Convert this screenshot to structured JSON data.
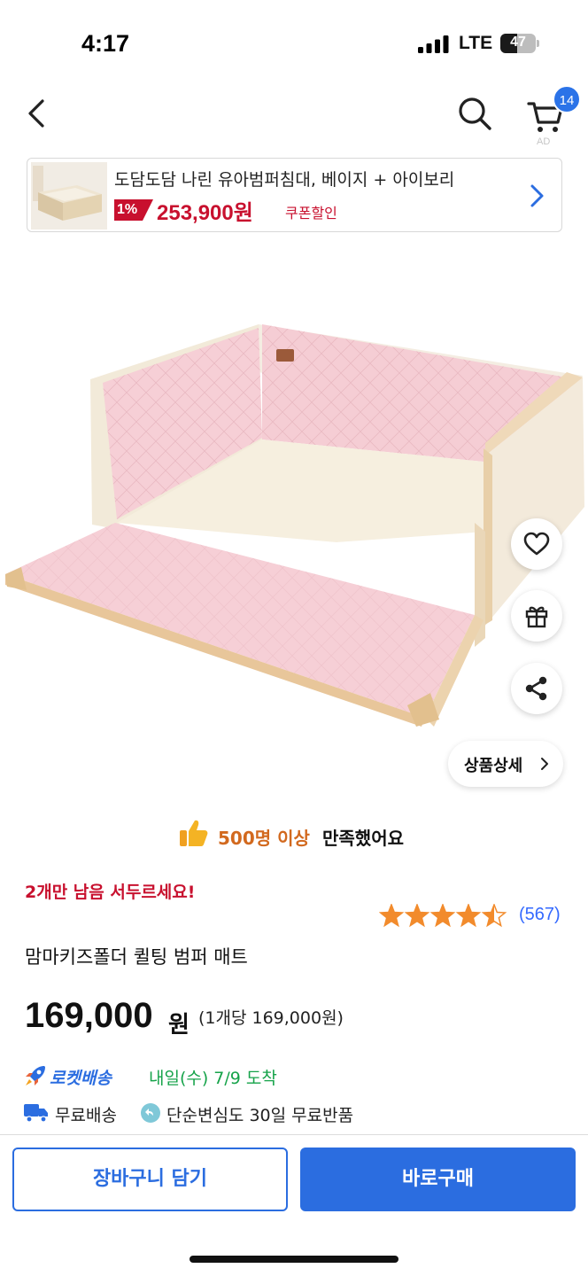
{
  "status_bar": {
    "time": "4:17",
    "network": "LTE",
    "battery_percent": "47",
    "battery_level": 0.47
  },
  "nav": {
    "back_icon": "chevron-left-icon",
    "search_icon": "search-icon",
    "cart_icon": "cart-icon",
    "cart_count": "14",
    "ad_label": "AD"
  },
  "ad_banner": {
    "title": "도담도담 나린 유아범퍼침대, 베이지 + 아이보리",
    "discount": "1%",
    "price": "253,900원",
    "coupon": "쿠폰할인"
  },
  "actions": {
    "wishlist_icon": "heart-icon",
    "gift_icon": "gift-icon",
    "share_icon": "share-icon",
    "detail_label": "상품상세"
  },
  "satisfaction": {
    "highlight": "500명 이상",
    "text": "만족했어요"
  },
  "urgency": "2개만 남음 서두르세요!",
  "rating": {
    "stars": 4.5,
    "count": "(567)"
  },
  "product": {
    "name": "맘마키즈폴더 퀼팅 범퍼 매트",
    "price": "169,000",
    "currency": "원",
    "unit_price": "(1개당 169,000원)"
  },
  "delivery": {
    "rocket_label": "로켓배송",
    "arrival": "내일(수) 7/9 도착",
    "free_shipping": "무료배송",
    "return_policy": "단순변심도 30일 무료반품"
  },
  "buttons": {
    "add_to_cart": "장바구니 담기",
    "buy_now": "바로구매"
  },
  "colors": {
    "accent_blue": "#2b6de0",
    "sale_red": "#c8102e",
    "rocket_green": "#16a34a",
    "star_orange": "#f28b2c"
  }
}
